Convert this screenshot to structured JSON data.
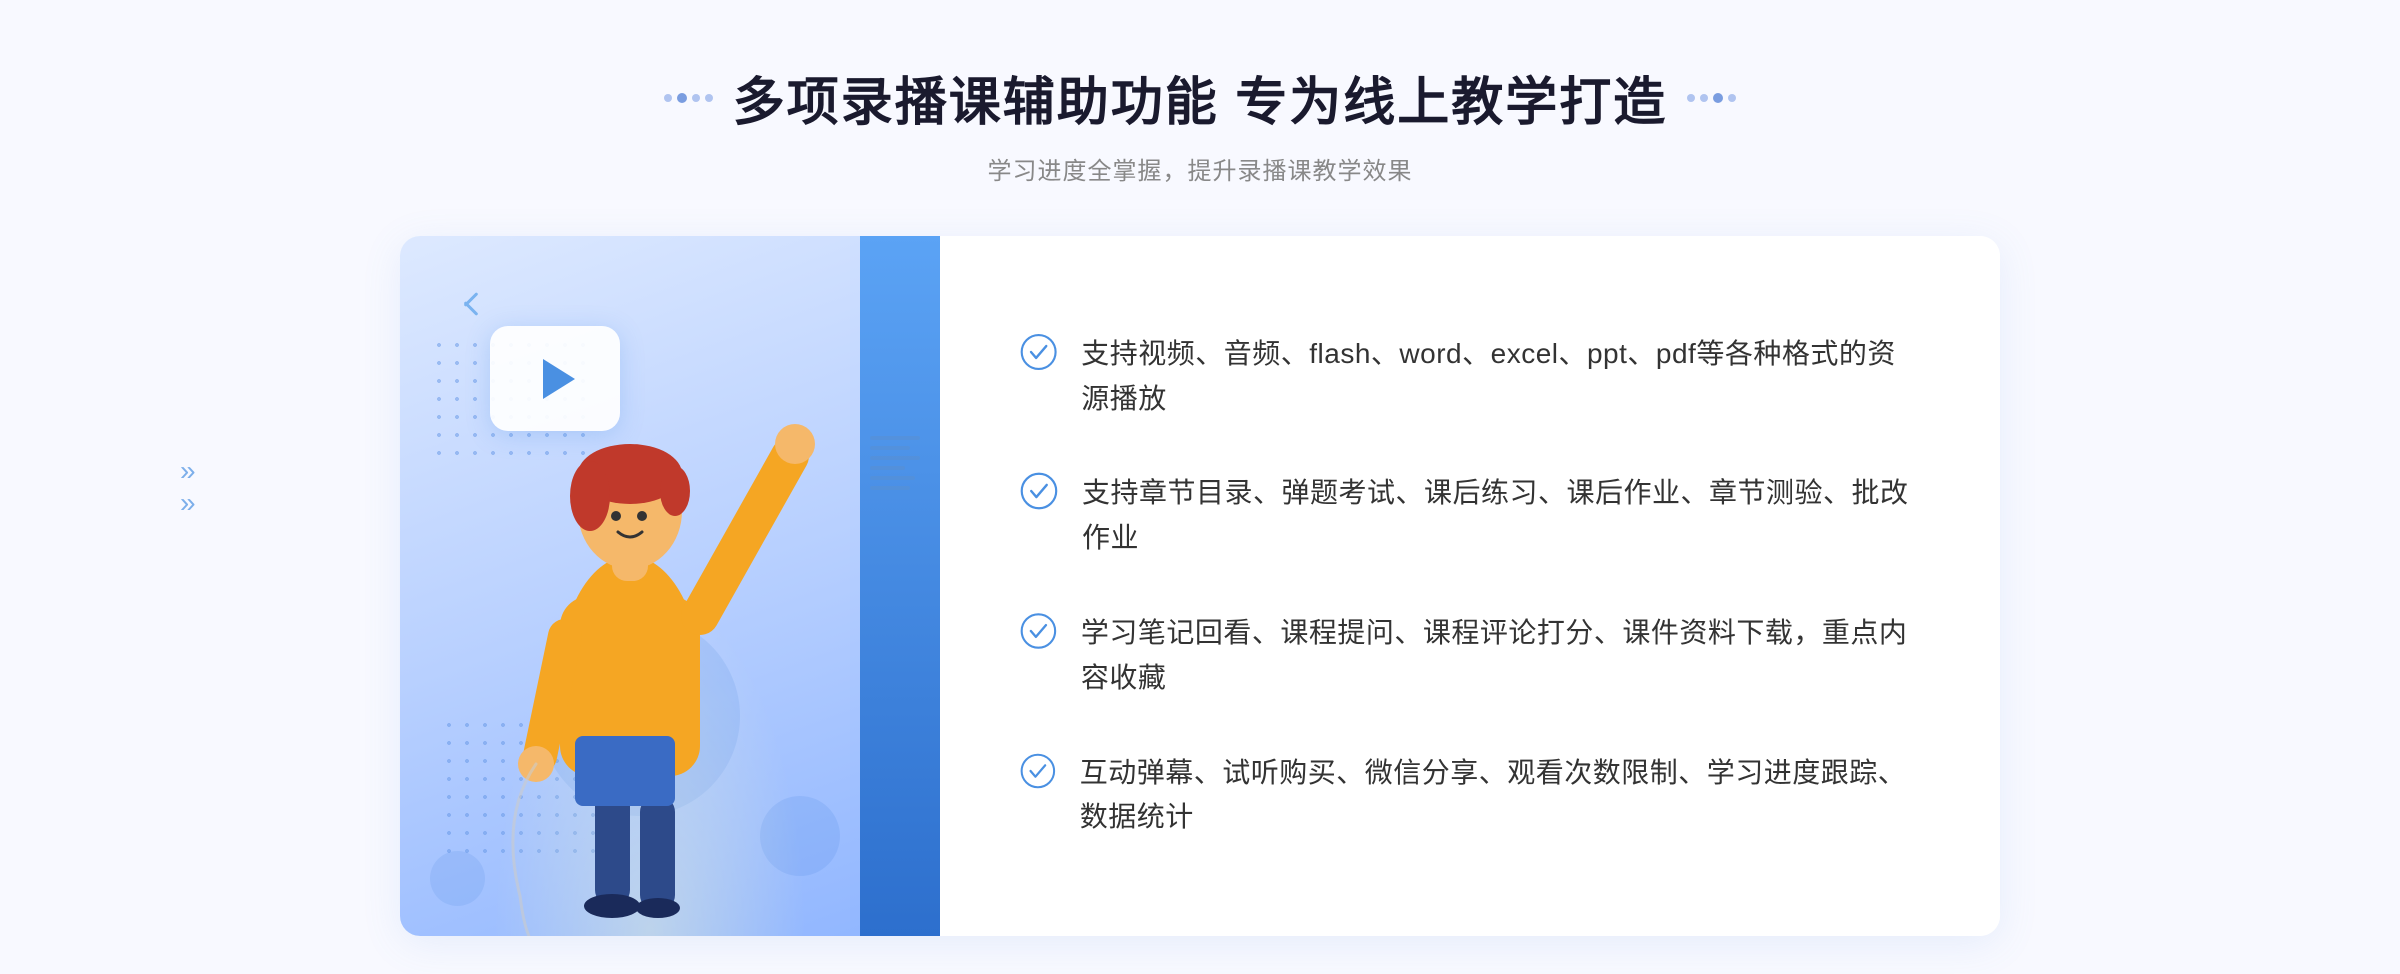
{
  "header": {
    "title": "多项录播课辅助功能 专为线上教学打造",
    "subtitle": "学习进度全掌握，提升录播课教学效果",
    "title_dots_label": "decorative dots"
  },
  "features": [
    {
      "id": 1,
      "text": "支持视频、音频、flash、word、excel、ppt、pdf等各种格式的资源播放"
    },
    {
      "id": 2,
      "text": "支持章节目录、弹题考试、课后练习、课后作业、章节测验、批改作业"
    },
    {
      "id": 3,
      "text": "学习笔记回看、课程提问、课程评论打分、课件资料下载，重点内容收藏"
    },
    {
      "id": 4,
      "text": "互动弹幕、试听购买、微信分享、观看次数限制、学习进度跟踪、数据统计"
    }
  ],
  "illustration": {
    "play_label": "play button"
  },
  "colors": {
    "primary": "#4a90e2",
    "accent": "#2d6fcd",
    "text_dark": "#1a1a2e",
    "text_gray": "#888888",
    "bg": "#f8f9ff",
    "check_color": "#4a90e2"
  }
}
